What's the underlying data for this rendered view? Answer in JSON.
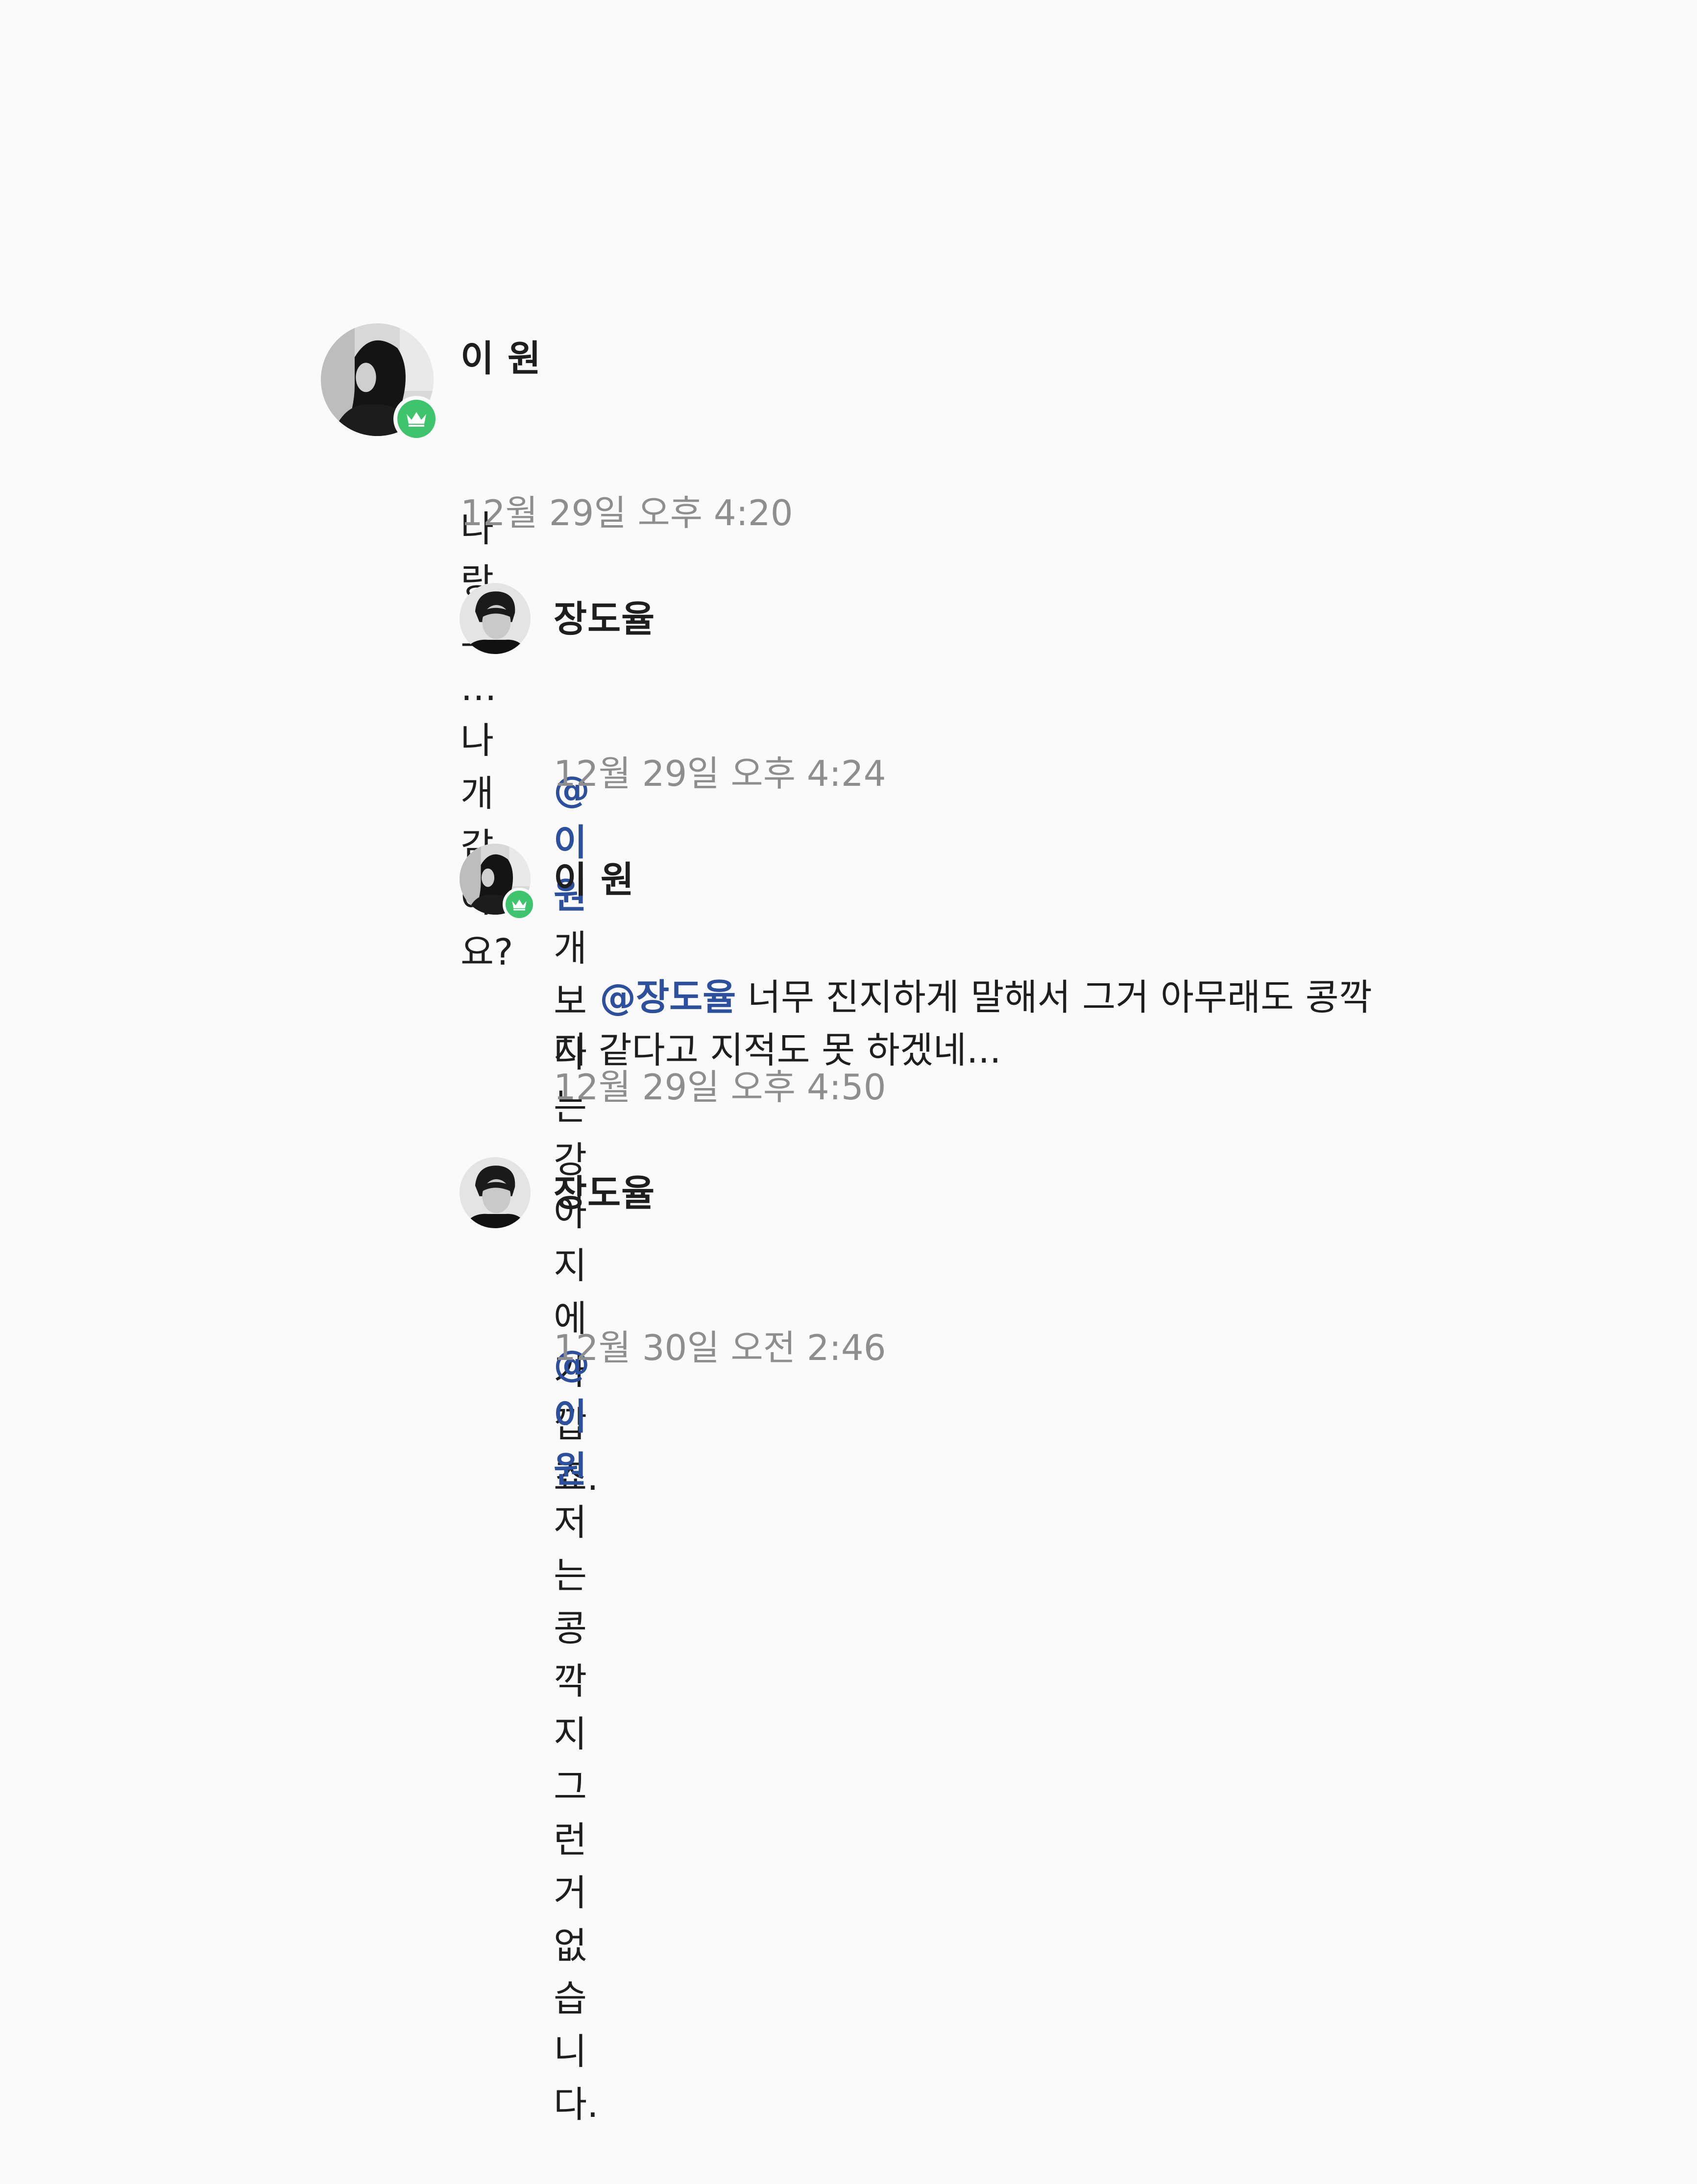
{
  "colors": {
    "background": "#fafafa",
    "text": "#1e1e1e",
    "mention": "#2c4f9e",
    "timestamp": "#8e8e8e",
    "badge": "#3ec46d"
  },
  "comments": [
    {
      "author": "이 원",
      "avatar": "woman-portrait-bw",
      "badge": "crown-icon",
      "mention": "",
      "text": "나랑요? … 나 개 같아요?",
      "time": "12월 29일 오후 4:20"
    },
    {
      "author": "장도율",
      "avatar": "man-portrait-bw",
      "badge": "",
      "mention": "@이 원",
      "text": " 개보다는 강아지에 가깝죠.",
      "time": "12월 29일 오후 4:24"
    },
    {
      "author": "이 원",
      "avatar": "woman-portrait-bw",
      "badge": "crown-icon",
      "mention": "@장도율",
      "text": " 너무 진지하게 말해서 그거 아무래도 콩깍\n지 같다고 지적도 못 하겠네...",
      "time": "12월 29일 오후 4:50"
    },
    {
      "author": "장도율",
      "avatar": "man-portrait-bw",
      "badge": "",
      "mention": "@이 원",
      "text": " 저는 콩깍지 그런 거 없습니다.",
      "time": "12월 30일 오전 2:46"
    }
  ]
}
